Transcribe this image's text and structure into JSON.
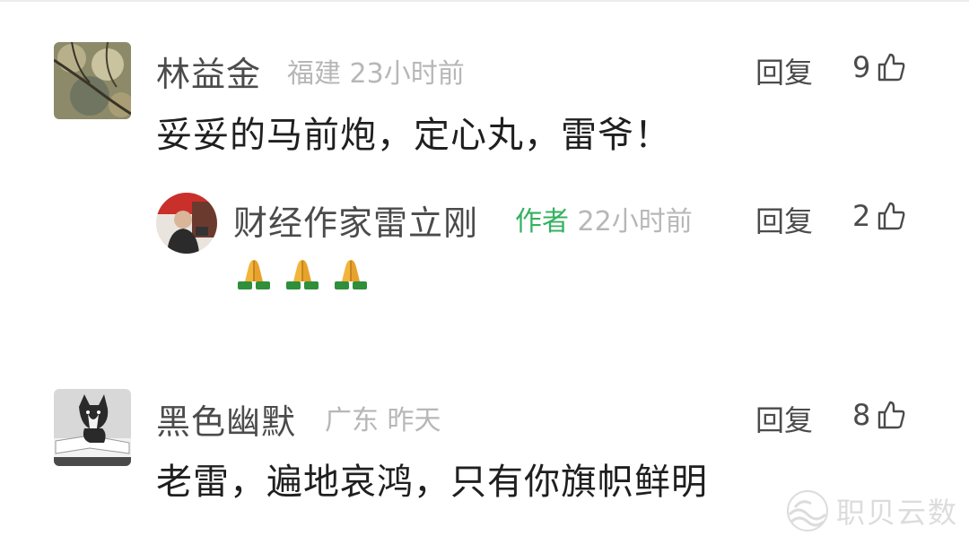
{
  "comments": [
    {
      "author": "林益金",
      "location": "福建",
      "time": "23小时前",
      "text": "妥妥的马前炮，定心丸，雷爷！",
      "reply_label": "回复",
      "likes": "9"
    },
    {
      "author": "财经作家雷立刚",
      "tag": "作者",
      "time": "22小时前",
      "reply_label": "回复",
      "likes": "2",
      "emojis": [
        "folded-hands-icon",
        "folded-hands-icon",
        "folded-hands-icon"
      ]
    },
    {
      "author": "黑色幽默",
      "location": "广东",
      "time": "昨天",
      "text": "老雷，遍地哀鸿，只有你旗帜鲜明",
      "reply_label": "回复",
      "likes": "8"
    }
  ],
  "watermark": {
    "text": "职贝云数",
    "icon": "wave-logo-icon"
  },
  "colors": {
    "author_tag": "#35b15f",
    "meta": "#b7b7b7",
    "name": "#4b4b4b",
    "body": "#1f1f1f"
  }
}
